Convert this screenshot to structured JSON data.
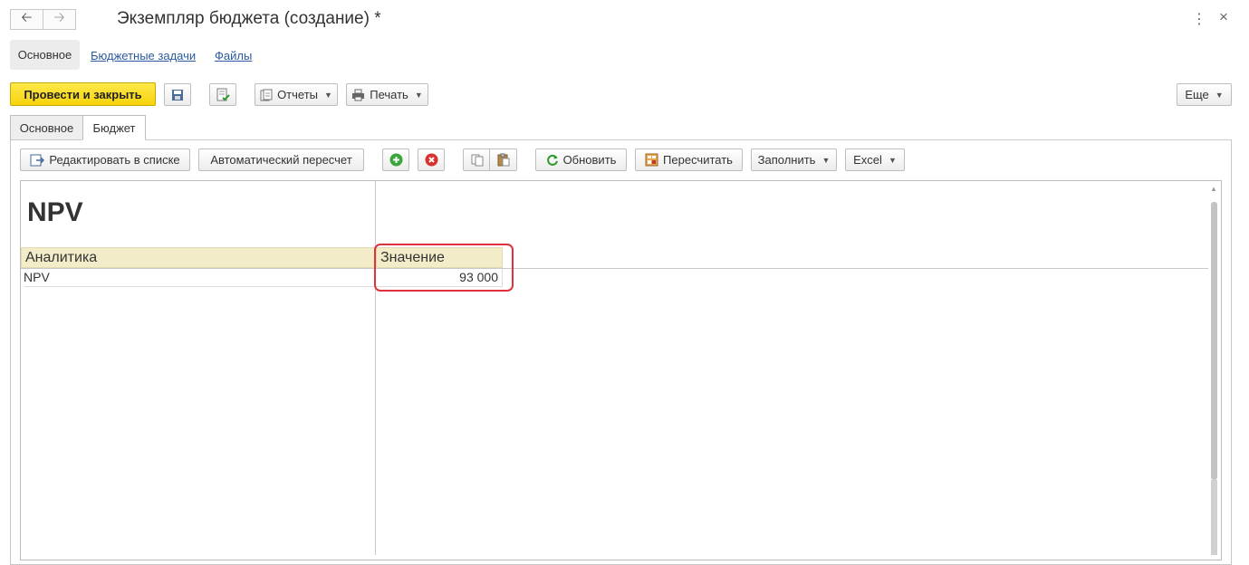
{
  "window": {
    "title": "Экземпляр бюджета (создание) *",
    "back_icon": "arrow-left-icon",
    "forward_icon": "arrow-right-icon",
    "menu_icon": "more-vertical-icon",
    "close_icon": "close-icon"
  },
  "sections": [
    {
      "label": "Основное",
      "active": true
    },
    {
      "label": "Бюджетные задачи",
      "active": false
    },
    {
      "label": "Файлы",
      "active": false
    }
  ],
  "toolbar": {
    "post_close_label": "Провести и закрыть",
    "save_icon": "save-icon",
    "post_icon": "post-document-icon",
    "reports_label": "Отчеты",
    "print_label": "Печать",
    "more_label": "Еще"
  },
  "tabs": [
    {
      "label": "Основное",
      "active": false
    },
    {
      "label": "Бюджет",
      "active": true
    }
  ],
  "budget_toolbar": {
    "edit_in_list_label": "Редактировать в списке",
    "auto_recalc_label": "Автоматический пересчет",
    "add_icon": "add-circle-icon",
    "delete_icon": "delete-circle-icon",
    "copy_icon": "copy-icon",
    "paste_icon": "paste-icon",
    "refresh_label": "Обновить",
    "recalc_label": "Пересчитать",
    "fill_label": "Заполнить",
    "excel_label": "Excel"
  },
  "table": {
    "title": "NPV",
    "columns": [
      "Аналитика",
      "Значение"
    ],
    "rows": [
      {
        "analytics": "NPV",
        "value": "93 000"
      }
    ]
  },
  "colors": {
    "accent_yellow": "#f7d30a",
    "highlight_red": "#e0323c",
    "header_bg": "#f2ecc9",
    "link_blue": "#2b5aa0"
  }
}
